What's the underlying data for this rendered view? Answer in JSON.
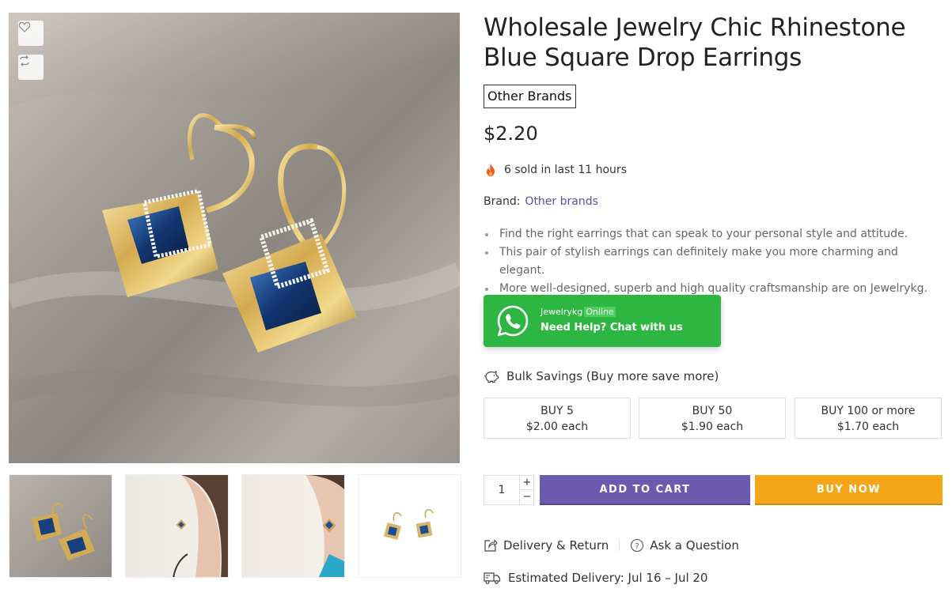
{
  "gallery": {
    "wishlist_icon": "heart-icon",
    "compare_icon": "compare-arrows-icon",
    "thumbnails": [
      "thumb-earrings-flatlay",
      "thumb-model-side",
      "thumb-model-closeup",
      "thumb-earrings-white"
    ]
  },
  "product": {
    "title": "Wholesale Jewelry Chic Rhinestone Blue Square Drop Earrings",
    "brand_badge": "Other Brands",
    "price": "$2.20",
    "sold_text": "6 sold in last 11 hours",
    "brand_label": "Brand:",
    "brand_link": "Other brands",
    "bullets": [
      "Find the right earrings that can speak to your personal style and attitude.",
      "This pair of stylish earrings can definitely make you more charming and elegant.",
      "More well-designed, superb and high quality craftsmanship are on Jewelrykg."
    ]
  },
  "whatsapp": {
    "name": "Jewelrykg",
    "status": "Online",
    "message": "Need Help? Chat with us"
  },
  "bulk": {
    "heading": "Bulk Savings (Buy more save more)",
    "tiers": [
      {
        "qty": "BUY 5",
        "price": "$2.00 each"
      },
      {
        "qty": "BUY 50",
        "price": "$1.90 each"
      },
      {
        "qty": "BUY 100 or more",
        "price": "$1.70 each"
      }
    ]
  },
  "cart": {
    "quantity": "1",
    "plus": "+",
    "minus": "−",
    "add_to_cart": "ADD TO CART",
    "buy_now": "BUY NOW"
  },
  "links": {
    "delivery_return": "Delivery & Return",
    "ask_question": "Ask a Question"
  },
  "delivery": {
    "estimated": "Estimated Delivery: Jul 16 – Jul 20"
  },
  "colors": {
    "accent_purple": "#6b5aad",
    "buy_orange": "#f4a518",
    "whatsapp_green": "#2db742",
    "link_purple": "#5a4fa6"
  }
}
